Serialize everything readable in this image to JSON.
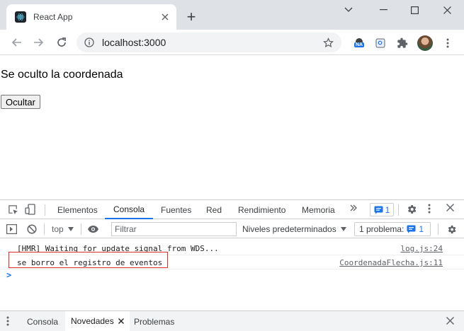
{
  "browser": {
    "tab_title": "React App",
    "new_tab_glyph": "+",
    "url": "localhost:3000",
    "extension_badge": "NA",
    "icons": [
      "react-favicon",
      "close-icon",
      "plus-icon",
      "back-icon",
      "forward-icon",
      "reload-icon",
      "info-icon",
      "star-icon",
      "puzzle-icon",
      "kebab-icon",
      "minimize-icon",
      "maximize-icon"
    ]
  },
  "page": {
    "message": "Se oculto la coordenada",
    "hide_button_label": "Ocultar"
  },
  "devtools": {
    "tabs": [
      {
        "label": "Elementos",
        "active": false
      },
      {
        "label": "Consola",
        "active": true
      },
      {
        "label": "Fuentes",
        "active": false
      },
      {
        "label": "Red",
        "active": false
      },
      {
        "label": "Rendimiento",
        "active": false
      },
      {
        "label": "Memoria",
        "active": false
      }
    ],
    "issues_count": "1",
    "toolbar": {
      "context": "top",
      "filter_placeholder": "Filtrar",
      "levels": "Niveles predeterminados",
      "problems_label": "1 problema:",
      "problems_count": "1"
    },
    "logs": [
      {
        "message": "[HMR] Waiting for update signal from WDS...",
        "source": "log.js:24"
      },
      {
        "message": "se borro el registro de eventos",
        "source": "CoordenadaFlecha.js:11"
      }
    ],
    "prompt_glyph": ">",
    "drawer_tabs": [
      {
        "label": "Consola",
        "active": false
      },
      {
        "label": "Novedades",
        "active": true
      },
      {
        "label": "Problemas",
        "active": false
      }
    ],
    "drawer_close_glyph": "✕"
  },
  "colors": {
    "accent": "#1a73e8",
    "highlight": "#d93025",
    "tabstrip": "#dee1e6"
  }
}
